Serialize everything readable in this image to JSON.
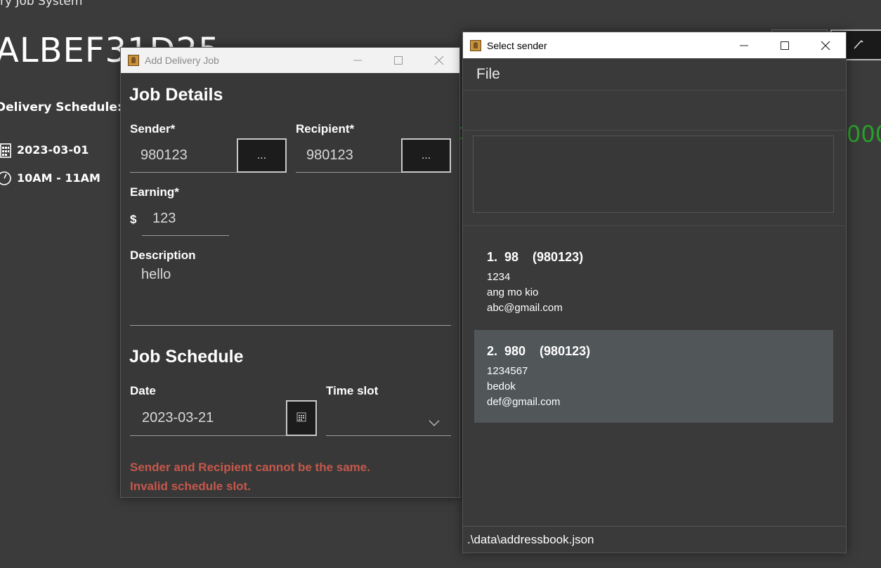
{
  "background": {
    "top_text": "ry Job System",
    "job_id": "ALBEF31D25",
    "schedule_label": "Delivery Schedule:",
    "date": "2023-03-01",
    "time": "10AM - 11AM",
    "green_text": "000",
    "green_left": "1",
    "green_color": "#2aa02a"
  },
  "add_job_window": {
    "title": "Add Delivery Job",
    "job_details_heading": "Job Details",
    "sender_label": "Sender*",
    "sender_value": "980123",
    "sender_browse": "...",
    "recipient_label": "Recipient*",
    "recipient_value": "980123",
    "recipient_browse": "...",
    "earning_label": "Earning*",
    "currency_symbol": "$",
    "earning_value": "123",
    "description_label": "Description",
    "description_value": "hello",
    "job_schedule_heading": "Job Schedule",
    "date_label": "Date",
    "date_value": "2023-03-21",
    "timeslot_label": "Time slot",
    "timeslot_value": "",
    "errors": [
      "Sender and Recipient cannot be the same.",
      "Invalid schedule slot."
    ],
    "error_color": "#c5584b"
  },
  "select_sender_window": {
    "title": "Select sender",
    "menu": [
      "File"
    ],
    "search_value": "",
    "contacts": [
      {
        "title": "1.  98    (980123)",
        "phone": "1234",
        "address": "ang mo kio",
        "email": "abc@gmail.com",
        "selected": false
      },
      {
        "title": "2.  980    (980123)",
        "phone": "1234567",
        "address": "bedok",
        "email": "def@gmail.com",
        "selected": true
      }
    ],
    "status_path": ".\\data\\addressbook.json"
  }
}
